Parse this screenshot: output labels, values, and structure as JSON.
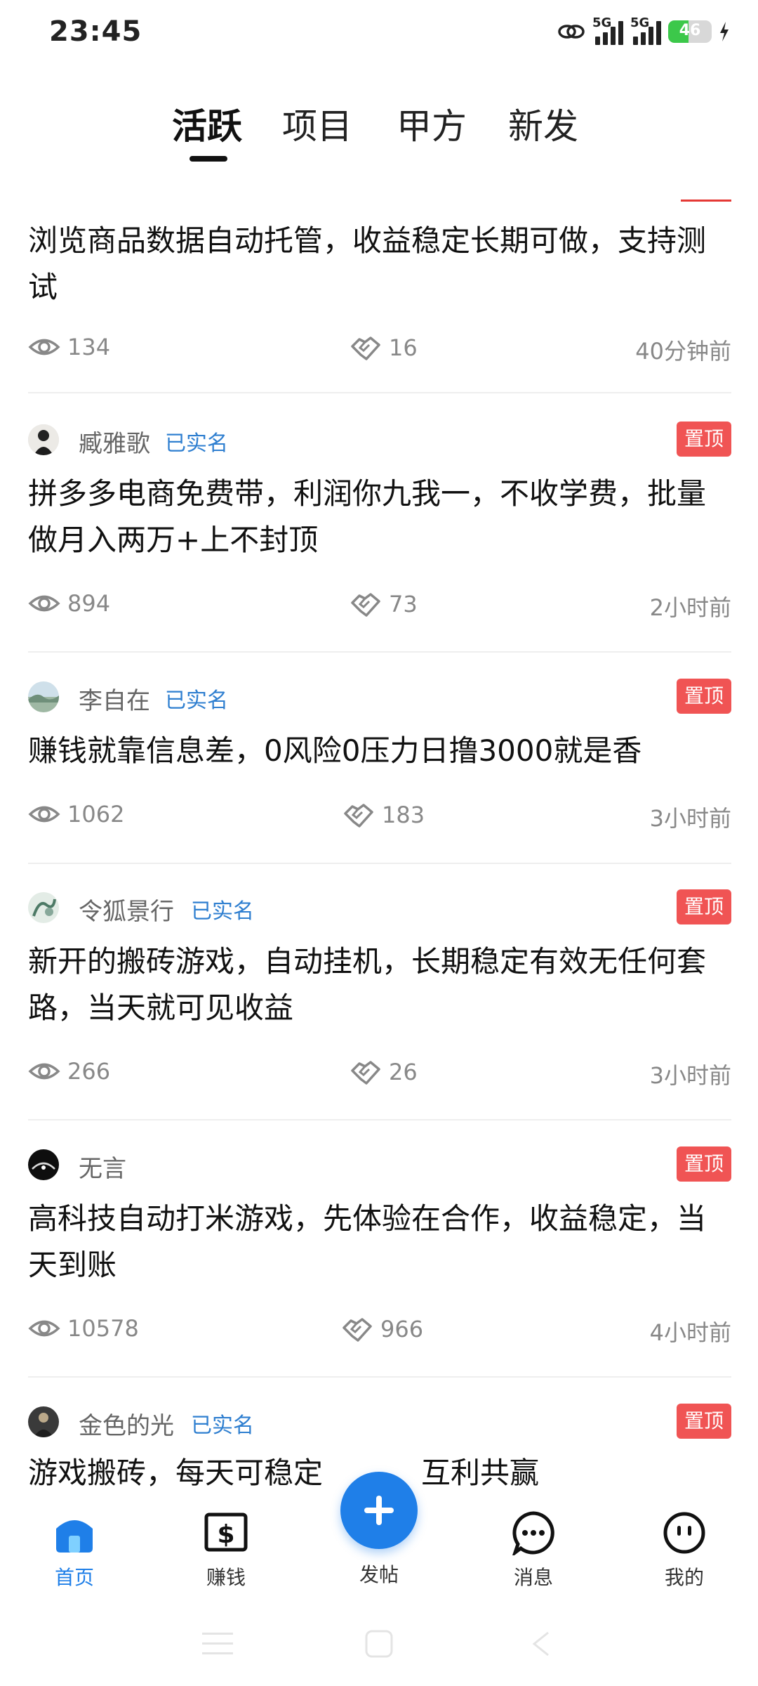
{
  "status": {
    "time": "23:45",
    "signal1": "5G",
    "signal2": "5G",
    "battery": "46",
    "battery_level": 46
  },
  "tabs": [
    {
      "label": "活跃",
      "active": true
    },
    {
      "label": "项目",
      "active": false
    },
    {
      "label": "甲方",
      "active": false
    },
    {
      "label": "新发",
      "active": false
    }
  ],
  "posts": [
    {
      "title": "浏览商品数据自动托管，收益稳定长期可做，支持测试",
      "views": "134",
      "likes": "16",
      "time": "40分钟前"
    },
    {
      "author": "臧雅歌",
      "verified": "已实名",
      "pin": "置顶",
      "title": "拼多多电商免费带，利润你九我一，不收学费，批量做月入两万+上不封顶",
      "views": "894",
      "likes": "73",
      "time": "2小时前"
    },
    {
      "author": "李自在",
      "verified": "已实名",
      "pin": "置顶",
      "title": "赚钱就靠信息差，0风险0压力日撸3000就是香",
      "views": "1062",
      "likes": "183",
      "time": "3小时前"
    },
    {
      "author": "令狐景行",
      "verified": "已实名",
      "pin": "置顶",
      "title": "新开的搬砖游戏，自动挂机，长期稳定有效无任何套路，当天就可见收益",
      "views": "266",
      "likes": "26",
      "time": "3小时前"
    },
    {
      "author": "无言",
      "pin": "置顶",
      "title": "高科技自动打米游戏，先体验在合作，收益稳定，当天到账",
      "views": "10578",
      "likes": "966",
      "time": "4小时前"
    },
    {
      "author": "金色的光",
      "verified": "已实名",
      "pin": "置顶",
      "title": "游戏搬砖，每天可稳定",
      "title_tail": "互利共赢"
    }
  ],
  "fab": {
    "label": "发帖"
  },
  "nav": [
    {
      "label": "首页",
      "icon": "home-icon",
      "active": true
    },
    {
      "label": "赚钱",
      "icon": "dollar-icon",
      "active": false
    },
    {
      "label": "消息",
      "icon": "message-icon",
      "active": false
    },
    {
      "label": "我的",
      "icon": "profile-icon",
      "active": false
    }
  ],
  "colors": {
    "accent": "#1f7fe8",
    "pin": "#f05454",
    "verified": "#2f7fd0",
    "battery": "#3cc84a"
  }
}
